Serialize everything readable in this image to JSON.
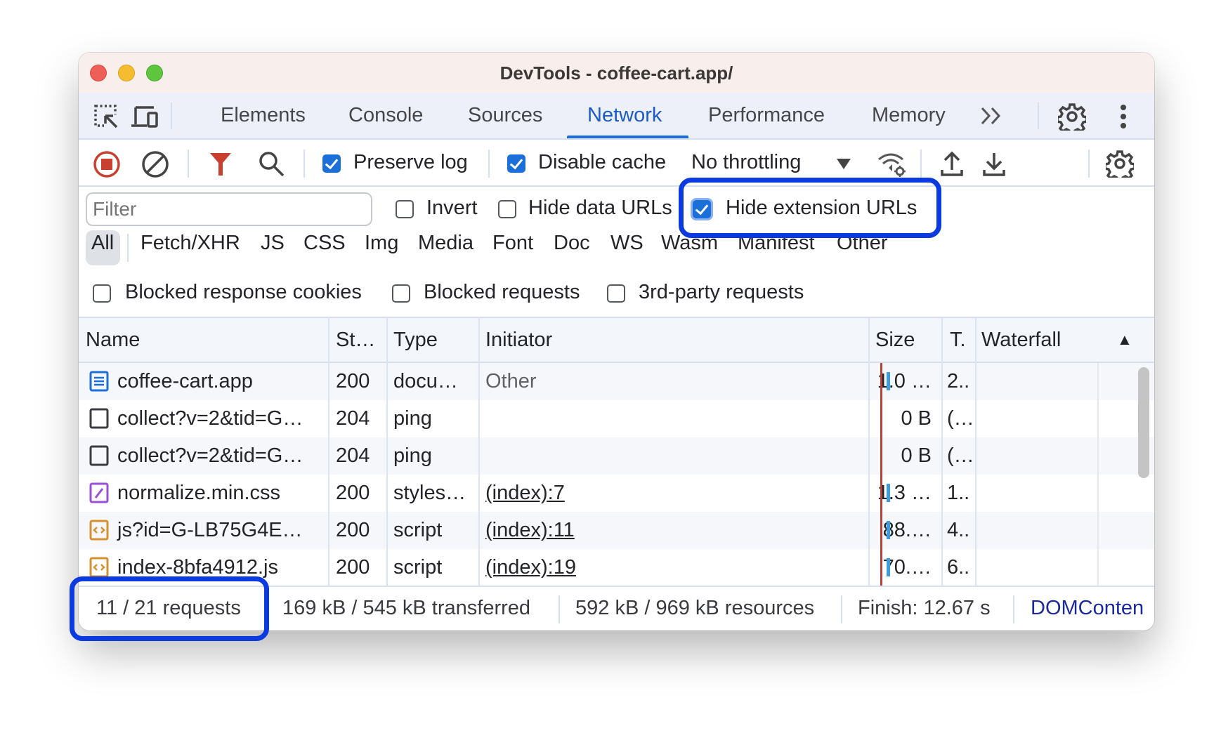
{
  "window": {
    "title": "DevTools - coffee-cart.app/"
  },
  "tabs": {
    "items": [
      {
        "label": "Elements"
      },
      {
        "label": "Console"
      },
      {
        "label": "Sources"
      },
      {
        "label": "Network",
        "active": true
      },
      {
        "label": "Performance"
      },
      {
        "label": "Memory"
      }
    ],
    "more_label": "»",
    "icons": [
      "inspect-element-icon",
      "device-toolbar-icon",
      "more-tabs-icon",
      "settings-gear-icon",
      "kebab-menu-icon"
    ]
  },
  "toolbar": {
    "preserve_log": {
      "label": "Preserve log",
      "checked": true
    },
    "disable_cache": {
      "label": "Disable cache",
      "checked": true
    },
    "throttling": {
      "value": "No throttling"
    },
    "icons": [
      "stop-recording-icon",
      "clear-icon",
      "filter-icon",
      "search-icon",
      "network-conditions-icon",
      "import-har-icon",
      "export-har-icon",
      "network-settings-icon"
    ]
  },
  "filters": {
    "filter_placeholder": "Filter",
    "invert": {
      "label": "Invert",
      "checked": false
    },
    "hide_data_urls": {
      "label": "Hide data URLs",
      "checked": false
    },
    "hide_extension_urls": {
      "label": "Hide extension URLs",
      "checked": true
    },
    "types": [
      "All",
      "Fetch/XHR",
      "JS",
      "CSS",
      "Img",
      "Media",
      "Font",
      "Doc",
      "WS",
      "Wasm",
      "Manifest",
      "Other"
    ],
    "active_type": "All",
    "blocked_response_cookies": {
      "label": "Blocked response cookies",
      "checked": false
    },
    "blocked_requests": {
      "label": "Blocked requests",
      "checked": false
    },
    "third_party_requests": {
      "label": "3rd-party requests",
      "checked": false
    }
  },
  "table": {
    "columns": [
      "Name",
      "St…",
      "Type",
      "Initiator",
      "Size",
      "T.",
      "Waterfall"
    ],
    "sort_indicator": "▲",
    "rows": [
      {
        "icon": "document-icon",
        "name": "coffee-cart.app",
        "status": "200",
        "type": "docu…",
        "initiator": "Other",
        "initiator_link": false,
        "size": "1.0 …",
        "time": "2..",
        "has_bar": true
      },
      {
        "icon": "blank-file-icon",
        "name": "collect?v=2&tid=G…",
        "status": "204",
        "type": "ping",
        "initiator": "",
        "initiator_link": false,
        "size": "0 B",
        "time": "(…",
        "has_bar": false
      },
      {
        "icon": "blank-file-icon",
        "name": "collect?v=2&tid=G…",
        "status": "204",
        "type": "ping",
        "initiator": "",
        "initiator_link": false,
        "size": "0 B",
        "time": "(…",
        "has_bar": false
      },
      {
        "icon": "stylesheet-icon",
        "name": "normalize.min.css",
        "status": "200",
        "type": "styles…",
        "initiator": "(index):7",
        "initiator_link": true,
        "size": "1.3 …",
        "time": "1..",
        "has_bar": true
      },
      {
        "icon": "script-icon",
        "name": "js?id=G-LB75G4E…",
        "status": "200",
        "type": "script",
        "initiator": "(index):11",
        "initiator_link": true,
        "size": "88.…",
        "time": "4..",
        "has_bar": true
      },
      {
        "icon": "script-icon",
        "name": "index-8bfa4912.js",
        "status": "200",
        "type": "script",
        "initiator": "(index):19",
        "initiator_link": true,
        "size": "70.…",
        "time": "6..",
        "has_bar": true
      }
    ]
  },
  "status_bar": {
    "requests": "11 / 21 requests",
    "transferred": "169 kB / 545 kB transferred",
    "resources": "592 kB / 969 kB resources",
    "finish": "Finish: 12.67 s",
    "domcontentloaded": "DOMConten"
  },
  "colors": {
    "accent": "#1a6fd8",
    "highlight": "#0b3be0",
    "record_red": "#c9402f",
    "waterfall_bar": "#3d9be0",
    "load_line": "#b5423a"
  }
}
